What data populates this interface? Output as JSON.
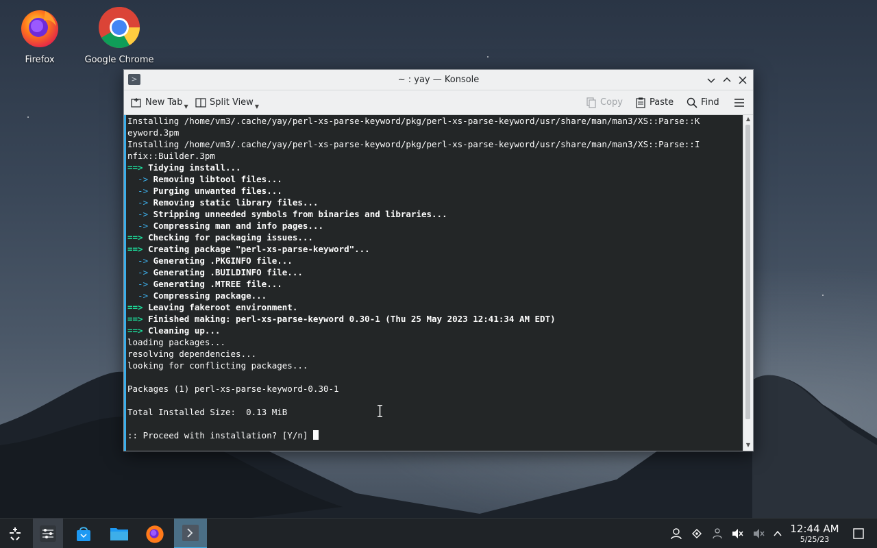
{
  "desktop": {
    "icons": [
      {
        "label": "Firefox",
        "icon": "firefox-icon"
      },
      {
        "label": "Google Chrome",
        "icon": "chrome-icon"
      }
    ]
  },
  "window": {
    "title": "~ : yay — Konsole",
    "toolbar": {
      "new_tab": "New Tab",
      "split_view": "Split View",
      "copy": "Copy",
      "paste": "Paste",
      "find": "Find"
    },
    "terminal": {
      "lines": [
        {
          "prefix": "",
          "text": "Installing /home/vm3/.cache/yay/perl-xs-parse-keyword/pkg/perl-xs-parse-keyword/usr/share/man/man3/XS::Parse::K",
          "style": "plain"
        },
        {
          "prefix": "",
          "text": "eyword.3pm",
          "style": "plain"
        },
        {
          "prefix": "",
          "text": "Installing /home/vm3/.cache/yay/perl-xs-parse-keyword/pkg/perl-xs-parse-keyword/usr/share/man/man3/XS::Parse::I",
          "style": "plain"
        },
        {
          "prefix": "",
          "text": "nfix::Builder.3pm",
          "style": "plain"
        },
        {
          "prefix": "==>",
          "text": " Tidying install...",
          "style": "green"
        },
        {
          "prefix": "  ->",
          "text": " Removing libtool files...",
          "style": "blue"
        },
        {
          "prefix": "  ->",
          "text": " Purging unwanted files...",
          "style": "blue"
        },
        {
          "prefix": "  ->",
          "text": " Removing static library files...",
          "style": "blue"
        },
        {
          "prefix": "  ->",
          "text": " Stripping unneeded symbols from binaries and libraries...",
          "style": "blue"
        },
        {
          "prefix": "  ->",
          "text": " Compressing man and info pages...",
          "style": "blue"
        },
        {
          "prefix": "==>",
          "text": " Checking for packaging issues...",
          "style": "green"
        },
        {
          "prefix": "==>",
          "text": " Creating package \"perl-xs-parse-keyword\"...",
          "style": "green"
        },
        {
          "prefix": "  ->",
          "text": " Generating .PKGINFO file...",
          "style": "blue"
        },
        {
          "prefix": "  ->",
          "text": " Generating .BUILDINFO file...",
          "style": "blue"
        },
        {
          "prefix": "  ->",
          "text": " Generating .MTREE file...",
          "style": "blue"
        },
        {
          "prefix": "  ->",
          "text": " Compressing package...",
          "style": "blue"
        },
        {
          "prefix": "==>",
          "text": " Leaving fakeroot environment.",
          "style": "green"
        },
        {
          "prefix": "==>",
          "text": " Finished making: perl-xs-parse-keyword 0.30-1 (Thu 25 May 2023 12:41:34 AM EDT)",
          "style": "green"
        },
        {
          "prefix": "==>",
          "text": " Cleaning up...",
          "style": "green"
        },
        {
          "prefix": "",
          "text": "loading packages...",
          "style": "plain"
        },
        {
          "prefix": "",
          "text": "resolving dependencies...",
          "style": "plain"
        },
        {
          "prefix": "",
          "text": "looking for conflicting packages...",
          "style": "plain"
        },
        {
          "prefix": "",
          "text": "",
          "style": "plain"
        },
        {
          "prefix": "",
          "text": "Packages (1) perl-xs-parse-keyword-0.30-1",
          "style": "plain"
        },
        {
          "prefix": "",
          "text": "",
          "style": "plain"
        },
        {
          "prefix": "",
          "text": "Total Installed Size:  0.13 MiB",
          "style": "plain"
        },
        {
          "prefix": "",
          "text": "",
          "style": "plain"
        },
        {
          "prefix": "",
          "text": ":: Proceed with installation? [Y/n] ",
          "style": "prompt"
        }
      ]
    }
  },
  "taskbar": {
    "clock": {
      "time": "12:44 AM",
      "date": "5/25/23"
    }
  },
  "colors": {
    "accent": "#3daee9",
    "green": "#1cdc9a",
    "terminal_bg": "#232627"
  }
}
